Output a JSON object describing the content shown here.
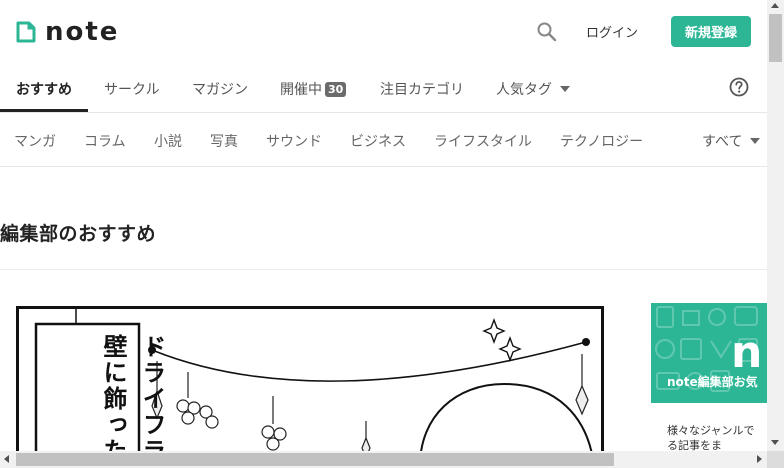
{
  "header": {
    "logo_text": "note",
    "login_label": "ログイン",
    "signup_label": "新規登録",
    "brand_color": "#2cb696",
    "icons": {
      "search": "search-icon",
      "logo": "note-logo-icon"
    }
  },
  "tabs": [
    {
      "label": "おすすめ",
      "active": true
    },
    {
      "label": "サークル"
    },
    {
      "label": "マガジン"
    },
    {
      "label": "開催中",
      "badge": "30"
    },
    {
      "label": "注目カテゴリ"
    },
    {
      "label": "人気タグ",
      "dropdown": true
    }
  ],
  "help_icon": "help-circle-icon",
  "categories": [
    "マンガ",
    "コラム",
    "小説",
    "写真",
    "サウンド",
    "ビジネス",
    "ライフスタイル",
    "テクノロジー"
  ],
  "categories_more": "すべて",
  "section": {
    "title": "編集部のおすすめ"
  },
  "manga": {
    "text_col1": "ドライフラ",
    "text_col2": "壁に飾った"
  },
  "promo": {
    "n_letter": "n",
    "title": "note編集部お気",
    "body_line1": "様々なジャンルで",
    "body_line2": "る記事をま"
  }
}
